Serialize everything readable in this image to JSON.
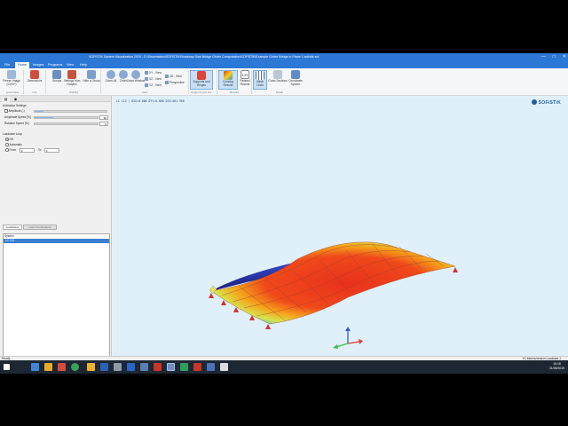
{
  "window": {
    "title": "SOFiSTiK System Visualization 2020 - D:\\Dissertation\\SOFiSTiK\\Roadway Slab Bridge Girder Computation\\SOFiSTiK\\Example Girder Bridge in Plane 1.sofistik.sof",
    "minimize": "—",
    "maximize": "□",
    "close": "✕"
  },
  "menu": {
    "tabs": [
      "File",
      "Home",
      "Images",
      "Programs",
      "View",
      "Help"
    ],
    "active": "Home"
  },
  "ribbon": {
    "buttons": [
      {
        "label": "Freeze Image (Ctrl+F)",
        "icon": "freeze-image-icon"
      },
      {
        "label": "Dimensions",
        "icon": "dimensions-icon"
      },
      {
        "label": "Groups",
        "icon": "groups-icon"
      },
      {
        "label": "Settings from Graphic",
        "icon": "settings-graphic-icon"
      },
      {
        "label": "Hide a Group",
        "icon": "hide-group-icon"
      },
      {
        "label": "Zoom All",
        "icon": "zoom-all-icon"
      },
      {
        "label": "Zoom",
        "icon": "zoom-icon"
      },
      {
        "label": "Zoom Window",
        "icon": "zoom-window-icon"
      },
      {
        "label": "Supports and Hinges",
        "icon": "supports-icon"
      },
      {
        "label": "Coloring Results",
        "icon": "coloring-icon"
      },
      {
        "label": "Related Results",
        "icon": "related-results-icon"
      },
      {
        "label": "Mesh Lines",
        "icon": "mesh-lines-icon"
      },
      {
        "label": "Cross Sections",
        "icon": "cross-sections-icon"
      },
      {
        "label": "Coordinate System",
        "icon": "coordinate-system-icon"
      }
    ],
    "view_small": [
      "XY - View",
      "XZ - View",
      "YZ - View",
      "3D - View",
      "Perspective"
    ],
    "related_number": "123",
    "groups": [
      "Load Case",
      "Info",
      "Visibility",
      "View",
      "Supports and Hin...",
      "Results",
      "Detail"
    ]
  },
  "panel": {
    "tabs": [
      "▤",
      "◉"
    ],
    "animation_title": "Animation Settings",
    "amplitude_label": "Amplitude (-)",
    "amplitude_fraction": 0.12,
    "amplitude_speed_label": "Amplitude Speed [%]",
    "amplitude_speed_value": "30",
    "amplitude_speed_fraction": 0.3,
    "rotation_speed_label": "Rotation Speed [%]",
    "rotation_speed_value": "0",
    "loadcase_loop_title": "Loadcase Loop",
    "off_label": "Off",
    "automatic_label": "Automatic",
    "from_label": "From",
    "from_value": "1",
    "to_label": "To",
    "to_value": "1",
    "lc_tabs": [
      "Loadcases",
      "Load Combinations"
    ],
    "list_header": "System",
    "selected_row": "LC 113"
  },
  "viewport": {
    "info": "LC 113  |  DXX=0.000  DYY=0.000  DZZ=261.966",
    "logo": "SOFiSTiK"
  },
  "status": {
    "left": "Ready",
    "right": "1/1 frames/version  Loadcase 1"
  },
  "taskbar": {
    "time": "16:18",
    "date": "31/05/2019"
  },
  "colors": {
    "accent": "#2b78d7",
    "viewport_bg": "#dff0fa",
    "result_high": "#e8311d",
    "result_low": "#3c8fe0"
  }
}
